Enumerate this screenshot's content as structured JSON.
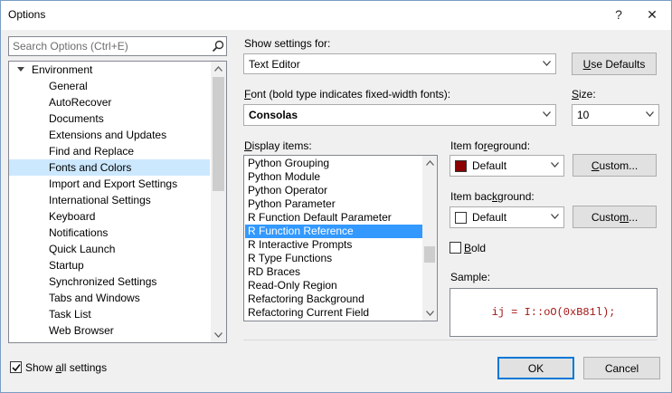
{
  "window": {
    "title": "Options",
    "help_glyph": "?",
    "close_glyph": "✕"
  },
  "search": {
    "placeholder": "Search Options (Ctrl+E)",
    "icon": "search-icon"
  },
  "tree": {
    "parent": "Environment",
    "items": [
      "General",
      "AutoRecover",
      "Documents",
      "Extensions and Updates",
      "Find and Replace",
      "Fonts and Colors",
      "Import and Export Settings",
      "International Settings",
      "Keyboard",
      "Notifications",
      "Quick Launch",
      "Startup",
      "Synchronized Settings",
      "Tabs and Windows",
      "Task List",
      "Web Browser"
    ],
    "selected_index": 5
  },
  "show_all": {
    "label_pre": "Show ",
    "label_u": "a",
    "label_post": "ll settings",
    "checked": true
  },
  "show_settings": {
    "label": "Show settings for:",
    "value": "Text Editor"
  },
  "use_defaults": {
    "u": "U",
    "rest": "se Defaults"
  },
  "font": {
    "label_u": "F",
    "label_rest": "ont (bold type indicates fixed-width fonts):",
    "value": "Consolas"
  },
  "size": {
    "label_u": "S",
    "label_rest": "ize:",
    "value": "10"
  },
  "display_items": {
    "label_u": "D",
    "label_rest": "isplay items:",
    "items": [
      "Python Grouping",
      "Python Module",
      "Python Operator",
      "Python Parameter",
      "R Function Default Parameter",
      "R Function Reference",
      "R Interactive Prompts",
      "R Type Functions",
      "RD Braces",
      "Read-Only Region",
      "Refactoring Background",
      "Refactoring Current Field"
    ],
    "selected_index": 5
  },
  "fg": {
    "label_pre": "Item fo",
    "label_u": "r",
    "label_post": "eground:",
    "value": "Default",
    "color": "#8b0000",
    "custom_u": "C",
    "custom_rest": "ustom..."
  },
  "bg": {
    "label_pre": "Item bac",
    "label_u": "k",
    "label_post": "ground:",
    "value": "Default",
    "color": "#ffffff",
    "custom_pre": "Custo",
    "custom_u": "m",
    "custom_post": "..."
  },
  "bold": {
    "label_u": "B",
    "label_rest": "old",
    "checked": false
  },
  "sample": {
    "label": "Sample:",
    "text": "ij = I::oO(0xB81l);",
    "color": "#a31515"
  },
  "buttons": {
    "ok": "OK",
    "cancel": "Cancel"
  },
  "colors": {
    "accent": "#0078d7",
    "selection": "#3399ff",
    "tree_selection": "#cce8ff"
  }
}
